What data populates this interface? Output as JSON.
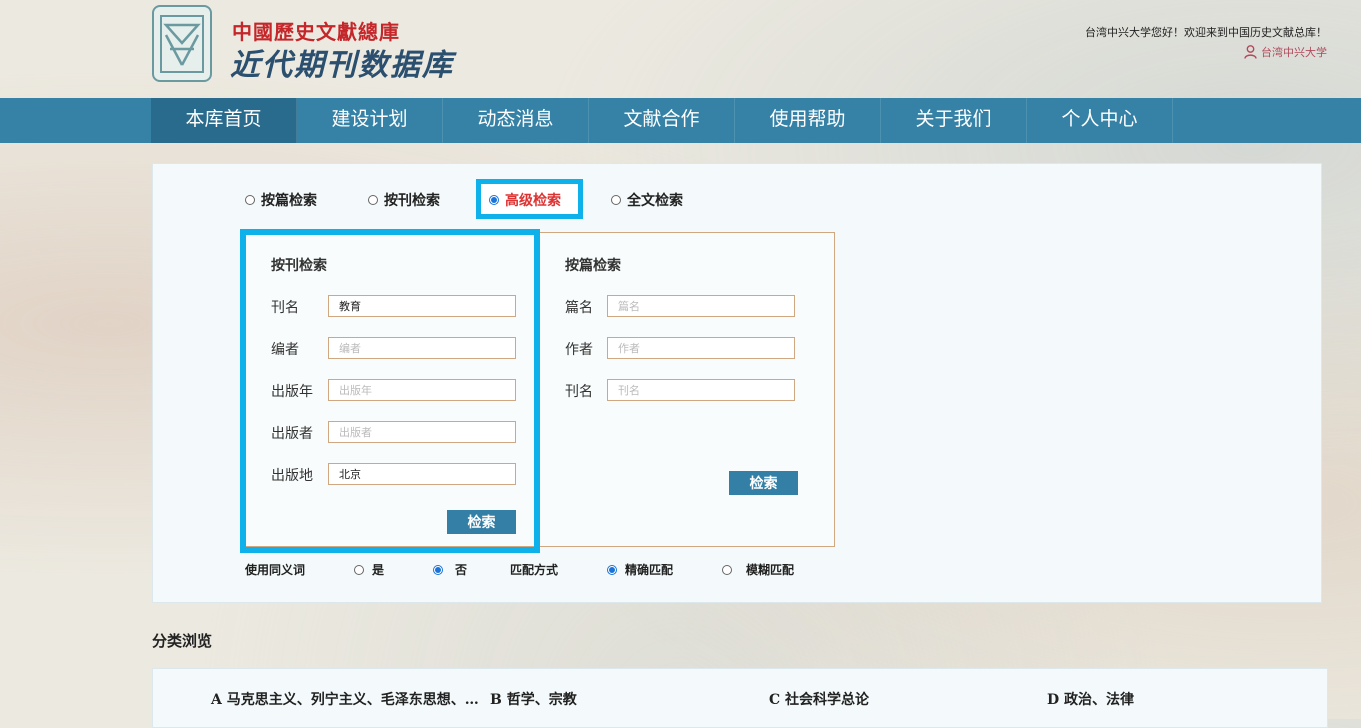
{
  "header": {
    "site_name_top": "中國歷史文獻總庫",
    "site_name_main": "近代期刊数据库",
    "welcome": "台湾中兴大学您好！欢迎来到中国历史文献总库！",
    "user_name": "台湾中兴大学"
  },
  "nav": {
    "items": [
      {
        "label": "本库首页"
      },
      {
        "label": "建设计划"
      },
      {
        "label": "动态消息"
      },
      {
        "label": "文献合作"
      },
      {
        "label": "使用帮助"
      },
      {
        "label": "关于我们"
      },
      {
        "label": "个人中心"
      }
    ],
    "active_index": 0
  },
  "search": {
    "modes": [
      {
        "label": "按篇检索",
        "selected": false
      },
      {
        "label": "按刊检索",
        "selected": false
      },
      {
        "label": "高级检索",
        "selected": true
      },
      {
        "label": "全文检索",
        "selected": false
      }
    ],
    "journal_section": {
      "title": "按刊检索",
      "fields": [
        {
          "label": "刊名",
          "value": "教育",
          "placeholder": "刊名"
        },
        {
          "label": "编者",
          "value": "",
          "placeholder": "编者"
        },
        {
          "label": "出版年",
          "value": "",
          "placeholder": "出版年"
        },
        {
          "label": "出版者",
          "value": "",
          "placeholder": "出版者"
        },
        {
          "label": "出版地",
          "value": "北京",
          "placeholder": "出版地"
        }
      ],
      "button": "检索"
    },
    "article_section": {
      "title": "按篇检索",
      "fields": [
        {
          "label": "篇名",
          "value": "",
          "placeholder": "篇名"
        },
        {
          "label": "作者",
          "value": "",
          "placeholder": "作者"
        },
        {
          "label": "刊名",
          "value": "",
          "placeholder": "刊名"
        }
      ],
      "button": "检索"
    },
    "options": {
      "synonym_label": "使用同义词",
      "synonym_yes": "是",
      "synonym_no": "否",
      "synonym_selected": "否",
      "match_label": "匹配方式",
      "match_exact": "精确匹配",
      "match_fuzzy": "模糊匹配",
      "match_selected": "精确匹配"
    }
  },
  "categories": {
    "title": "分类浏览",
    "items": [
      {
        "label": "A 马克思主义、列宁主义、毛泽东思想、…"
      },
      {
        "label": "B 哲学、宗教"
      },
      {
        "label": "C 社会科学总论"
      },
      {
        "label": "D 政治、法律"
      }
    ]
  },
  "colors": {
    "nav_bg": "#3582a6",
    "highlight": "#0fb1ea",
    "button_bg": "#337fa6",
    "brand_red": "#c4262a"
  }
}
